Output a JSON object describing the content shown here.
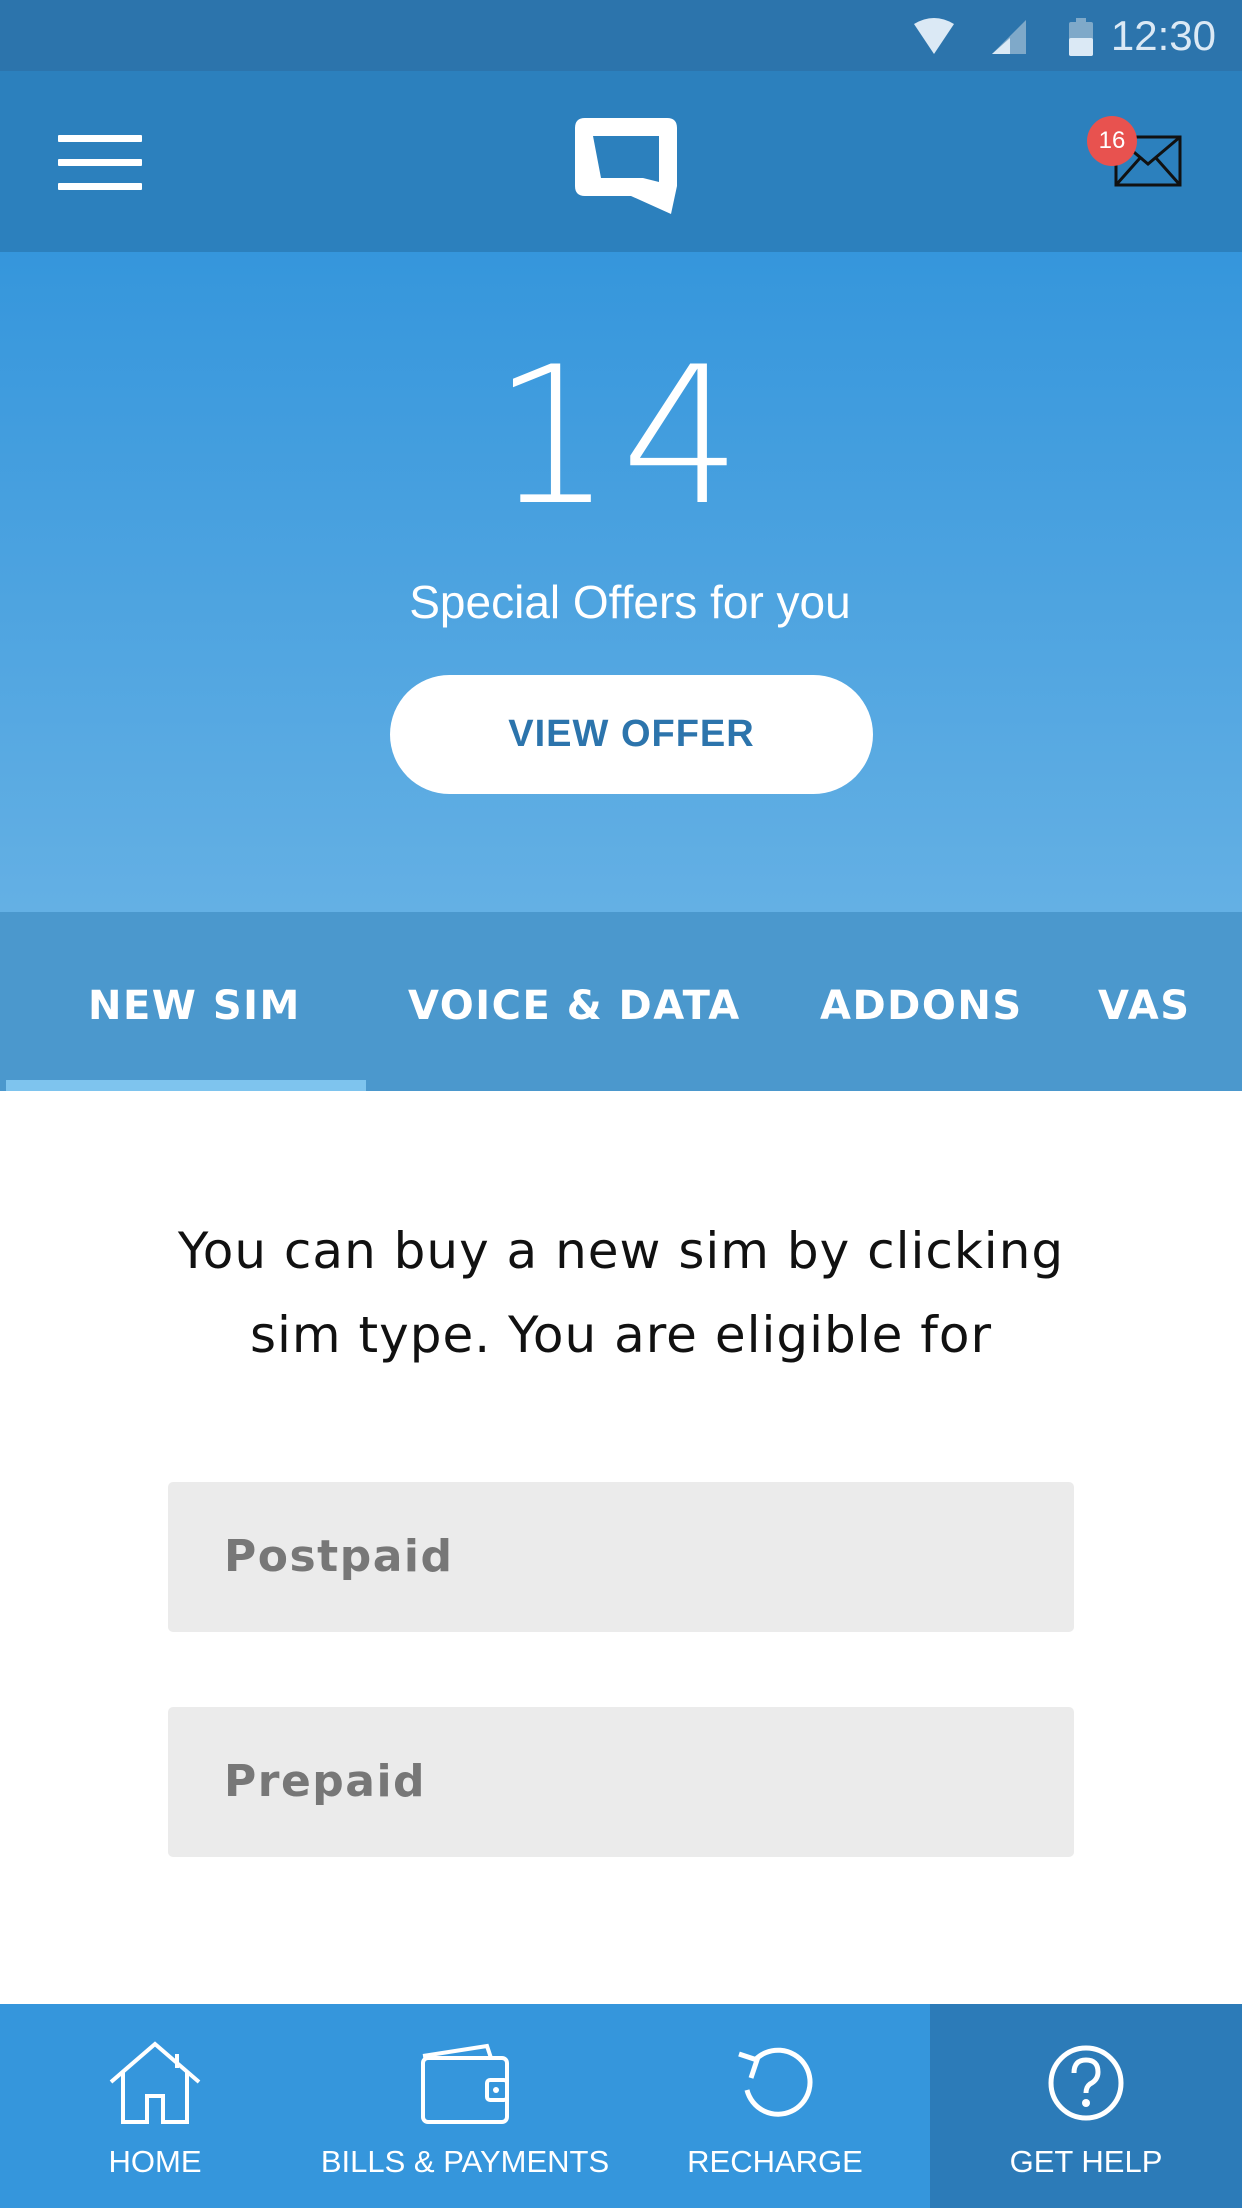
{
  "status_bar": {
    "time": "12:30",
    "icons": [
      "wifi-icon",
      "cell-signal-icon",
      "battery-icon"
    ]
  },
  "header": {
    "logo": "brand-logo",
    "menu_icon": "hamburger-menu-icon",
    "mail_icon": "envelope-icon",
    "mail_badge": "16"
  },
  "hero": {
    "offer_count": "14",
    "offer_text": "Special Offers for you",
    "button_label": "VIEW OFFER"
  },
  "tabs": {
    "items": [
      {
        "label": "NEW SIM",
        "active": true
      },
      {
        "label": "VOICE & DATA",
        "active": false
      },
      {
        "label": "ADDONS",
        "active": false
      },
      {
        "label": "VAS",
        "active": false
      }
    ]
  },
  "content": {
    "description_line1": "You can buy a new sim by clicking",
    "description_line2": "sim type. You are eligible for",
    "options": [
      {
        "label": "Postpaid"
      },
      {
        "label": "Prepaid"
      }
    ]
  },
  "bottom_nav": {
    "items": [
      {
        "label": "HOME",
        "icon": "home-icon",
        "active": false
      },
      {
        "label": "BILLS & PAYMENTS",
        "icon": "wallet-icon",
        "active": false
      },
      {
        "label": "RECHARGE",
        "icon": "refresh-icon",
        "active": false
      },
      {
        "label": "GET HELP",
        "icon": "help-icon",
        "active": true
      }
    ]
  },
  "colors": {
    "header_blue": "#2c80bd",
    "status_bar": "#2c74ac",
    "hero_top": "#3596dc",
    "hero_bottom": "#64b0e4",
    "tab_bar": "#4b98cd",
    "tab_indicator": "#7ec4ee",
    "badge_red": "#e8524f",
    "nav_blue": "#3596dc",
    "nav_active": "#2c7bb8",
    "option_gray": "#ebebeb"
  }
}
